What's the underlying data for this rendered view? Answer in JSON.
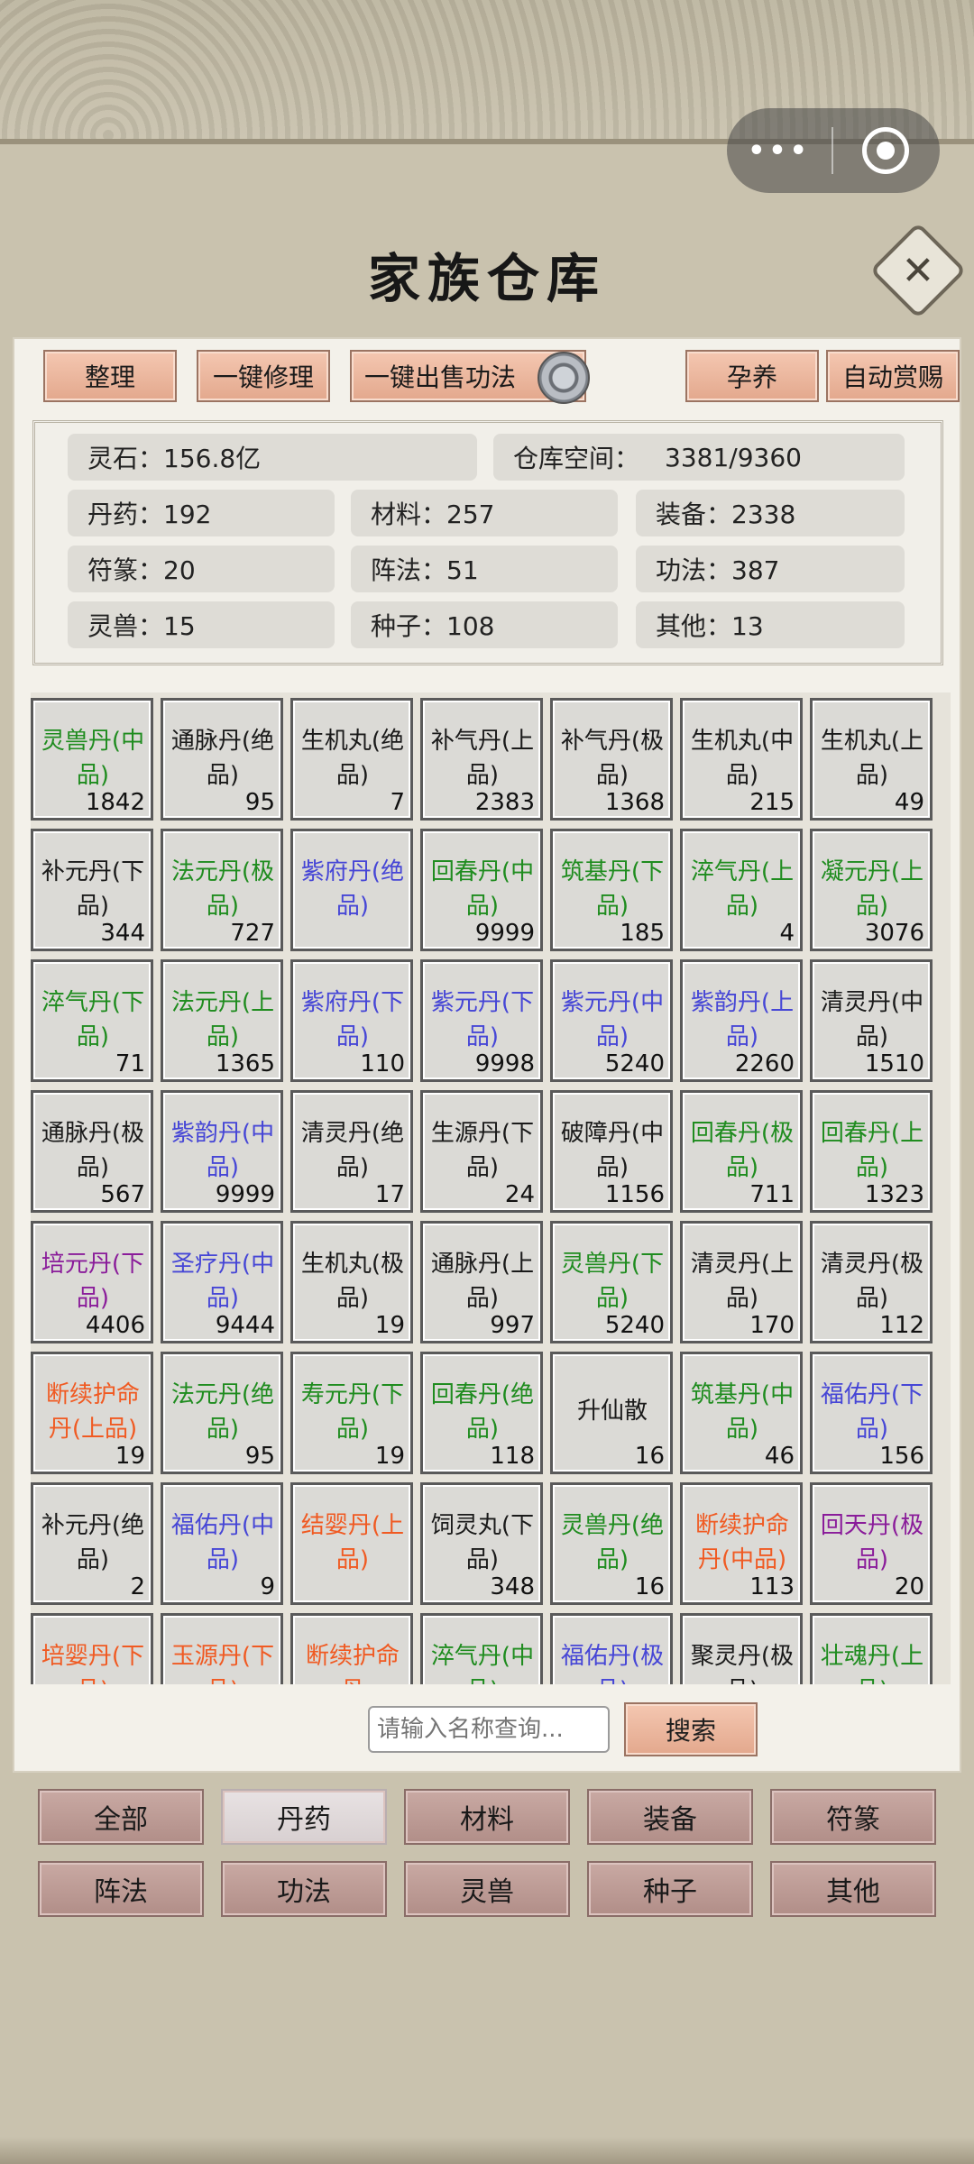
{
  "capsule": {
    "more_icon": "more-dots-icon",
    "close_icon": "mini-program-close-icon"
  },
  "title": "家族仓库",
  "toolbar": {
    "arrange": "整理",
    "repair_all": "一键修理",
    "sell_skills": "一键出售功法",
    "nurture": "孕养",
    "auto_reward": "自动赏赐"
  },
  "stats": {
    "spirit_stone": "灵石：156.8亿",
    "space_label": "仓库空间：",
    "space_value": "3381/9360",
    "pills": "丹药：192",
    "materials": "材料：257",
    "equipment": "装备：2338",
    "talismans": "符篆：20",
    "formations": "阵法：51",
    "skills": "功法：387",
    "beasts": "灵兽：15",
    "seeds": "种子：108",
    "others": "其他：13"
  },
  "colors": {
    "green": "#1f8c1f",
    "black": "#1a1a1a",
    "blue": "#4646d6",
    "purple": "#8a1c9a",
    "orange": "#f05a22"
  },
  "items": [
    {
      "name": "灵兽丹(中品)",
      "count": "1842",
      "color": "green"
    },
    {
      "name": "通脉丹(绝品)",
      "count": "95",
      "color": "black"
    },
    {
      "name": "生机丸(绝品)",
      "count": "7",
      "color": "black"
    },
    {
      "name": "补气丹(上品)",
      "count": "2383",
      "color": "black"
    },
    {
      "name": "补气丹(极品)",
      "count": "1368",
      "color": "black"
    },
    {
      "name": "生机丸(中品)",
      "count": "215",
      "color": "black"
    },
    {
      "name": "生机丸(上品)",
      "count": "49",
      "color": "black"
    },
    {
      "name": "补元丹(下品)",
      "count": "344",
      "color": "black"
    },
    {
      "name": "法元丹(极品)",
      "count": "727",
      "color": "green"
    },
    {
      "name": "紫府丹(绝品)",
      "count": "",
      "color": "blue"
    },
    {
      "name": "回春丹(中品)",
      "count": "9999",
      "color": "green"
    },
    {
      "name": "筑基丹(下品)",
      "count": "185",
      "color": "green"
    },
    {
      "name": "淬气丹(上品)",
      "count": "4",
      "color": "green"
    },
    {
      "name": "凝元丹(上品)",
      "count": "3076",
      "color": "green"
    },
    {
      "name": "淬气丹(下品)",
      "count": "71",
      "color": "green"
    },
    {
      "name": "法元丹(上品)",
      "count": "1365",
      "color": "green"
    },
    {
      "name": "紫府丹(下品)",
      "count": "110",
      "color": "blue"
    },
    {
      "name": "紫元丹(下品)",
      "count": "9998",
      "color": "blue"
    },
    {
      "name": "紫元丹(中品)",
      "count": "5240",
      "color": "blue"
    },
    {
      "name": "紫韵丹(上品)",
      "count": "2260",
      "color": "blue"
    },
    {
      "name": "清灵丹(中品)",
      "count": "1510",
      "color": "black"
    },
    {
      "name": "通脉丹(极品)",
      "count": "567",
      "color": "black"
    },
    {
      "name": "紫韵丹(中品)",
      "count": "9999",
      "color": "blue"
    },
    {
      "name": "清灵丹(绝品)",
      "count": "17",
      "color": "black"
    },
    {
      "name": "生源丹(下品)",
      "count": "24",
      "color": "black"
    },
    {
      "name": "破障丹(中品)",
      "count": "1156",
      "color": "black"
    },
    {
      "name": "回春丹(极品)",
      "count": "711",
      "color": "green"
    },
    {
      "name": "回春丹(上品)",
      "count": "1323",
      "color": "green"
    },
    {
      "name": "培元丹(下品)",
      "count": "4406",
      "color": "purple"
    },
    {
      "name": "圣疗丹(中品)",
      "count": "9444",
      "color": "blue"
    },
    {
      "name": "生机丸(极品)",
      "count": "19",
      "color": "black"
    },
    {
      "name": "通脉丹(上品)",
      "count": "997",
      "color": "black"
    },
    {
      "name": "灵兽丹(下品)",
      "count": "5240",
      "color": "green"
    },
    {
      "name": "清灵丹(上品)",
      "count": "170",
      "color": "black"
    },
    {
      "name": "清灵丹(极品)",
      "count": "112",
      "color": "black"
    },
    {
      "name": "断续护命丹(上品)",
      "count": "19",
      "color": "orange"
    },
    {
      "name": "法元丹(绝品)",
      "count": "95",
      "color": "green"
    },
    {
      "name": "寿元丹(下品)",
      "count": "19",
      "color": "green"
    },
    {
      "name": "回春丹(绝品)",
      "count": "118",
      "color": "green"
    },
    {
      "name": "升仙散",
      "count": "16",
      "color": "black",
      "single": true
    },
    {
      "name": "筑基丹(中品)",
      "count": "46",
      "color": "green"
    },
    {
      "name": "福佑丹(下品)",
      "count": "156",
      "color": "blue"
    },
    {
      "name": "补元丹(绝品)",
      "count": "2",
      "color": "black"
    },
    {
      "name": "福佑丹(中品)",
      "count": "9",
      "color": "blue"
    },
    {
      "name": "结婴丹(上品)",
      "count": "",
      "color": "orange"
    },
    {
      "name": "饲灵丸(下品)",
      "count": "348",
      "color": "black"
    },
    {
      "name": "灵兽丹(绝品)",
      "count": "16",
      "color": "green"
    },
    {
      "name": "断续护命丹(中品)",
      "count": "113",
      "color": "orange"
    },
    {
      "name": "回天丹(极品)",
      "count": "20",
      "color": "purple"
    },
    {
      "name": "培婴丹(下品)",
      "count": "",
      "color": "orange"
    },
    {
      "name": "玉源丹(下品)",
      "count": "",
      "color": "orange"
    },
    {
      "name": "断续护命丹",
      "count": "",
      "color": "orange"
    },
    {
      "name": "淬气丹(中品)",
      "count": "",
      "color": "green"
    },
    {
      "name": "福佑丹(极品)",
      "count": "",
      "color": "blue"
    },
    {
      "name": "聚灵丹(极品)",
      "count": "",
      "color": "black"
    },
    {
      "name": "壮魂丹(上品)",
      "count": "",
      "color": "green"
    }
  ],
  "search": {
    "placeholder": "请输入名称查询...",
    "button": "搜索"
  },
  "tabs": [
    "全部",
    "丹药",
    "材料",
    "装备",
    "符篆",
    "阵法",
    "功法",
    "灵兽",
    "种子",
    "其他"
  ],
  "active_tab": 1
}
